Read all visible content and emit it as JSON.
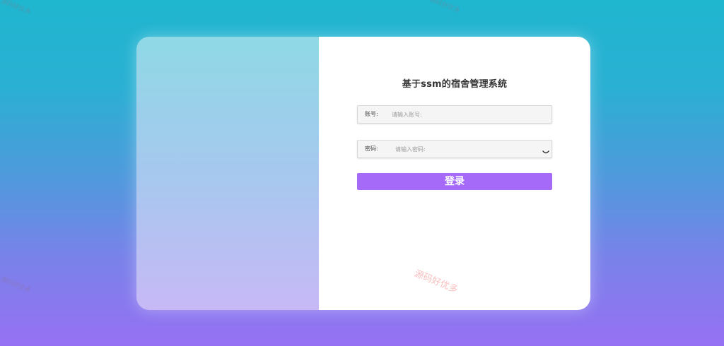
{
  "login": {
    "title": "基于ssm的宿舍管理系统",
    "account_label": "账号:",
    "account_placeholder": "请输入账号:",
    "password_label": "密码:",
    "password_placeholder": "请输入密码:",
    "submit_label": "登录"
  },
  "watermark": {
    "text": "源码好优多"
  },
  "icons": {
    "password_toggle": "eye-closed-icon"
  },
  "colors": {
    "button": "#a56bf8",
    "background_top": "#1fb6cf",
    "background_bottom": "#9670f3"
  }
}
